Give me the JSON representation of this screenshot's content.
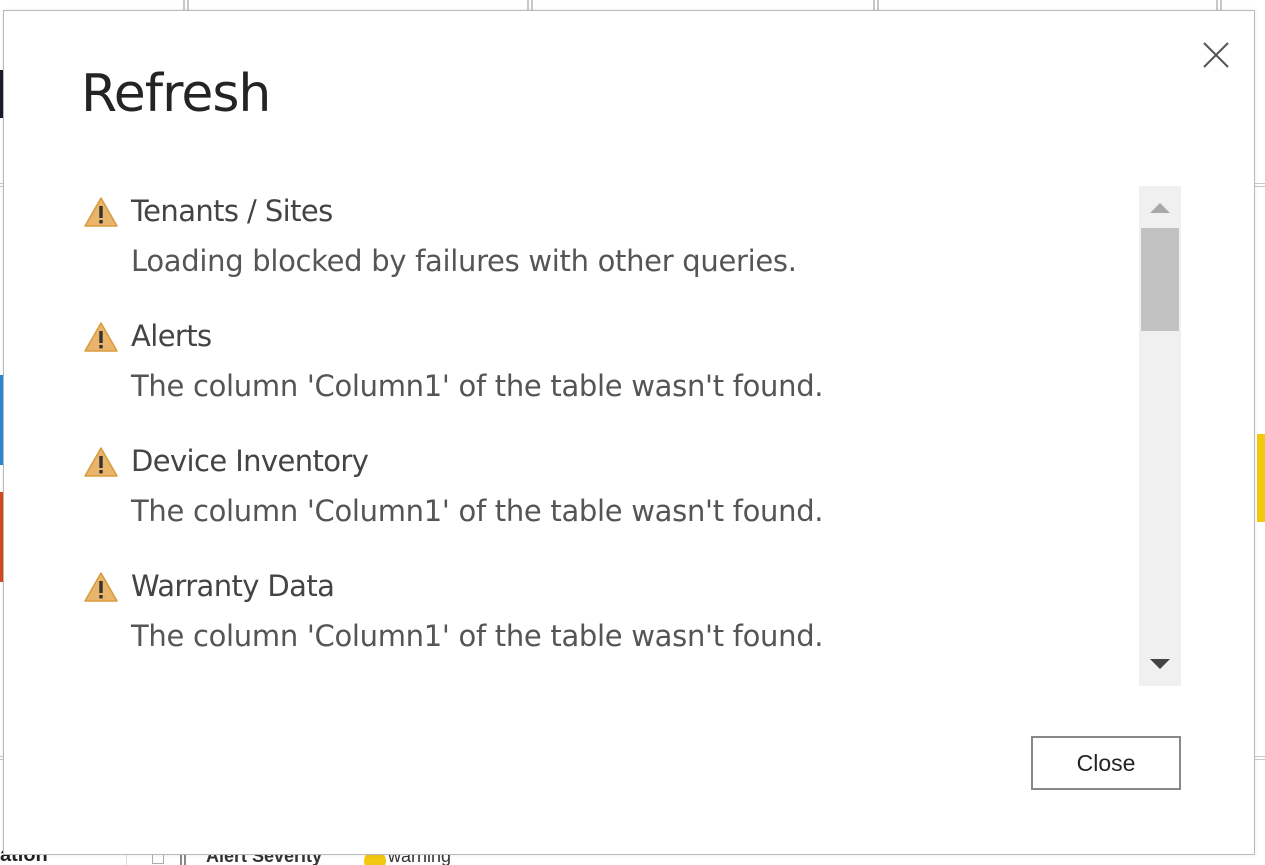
{
  "background": {
    "bottom_bar": {
      "partial_text": "ation",
      "field_label": "Alert Severity",
      "field_value": "warning"
    }
  },
  "dialog": {
    "title": "Refresh",
    "close_icon": "close-icon",
    "items": [
      {
        "icon": "warning-icon",
        "title": "Tenants / Sites",
        "message": "Loading blocked by failures with other queries."
      },
      {
        "icon": "warning-icon",
        "title": "Alerts",
        "message": "The column 'Column1' of the table wasn't found."
      },
      {
        "icon": "warning-icon",
        "title": "Device Inventory",
        "message": "The column 'Column1' of the table wasn't found."
      },
      {
        "icon": "warning-icon",
        "title": "Warranty Data",
        "message": "The column 'Column1' of the table wasn't found."
      }
    ],
    "close_button_label": "Close"
  },
  "colors": {
    "warning": "#e8a94d",
    "accent_blue": "#2b88d8",
    "accent_orange": "#d84a1b",
    "accent_yellow": "#f2c811"
  }
}
